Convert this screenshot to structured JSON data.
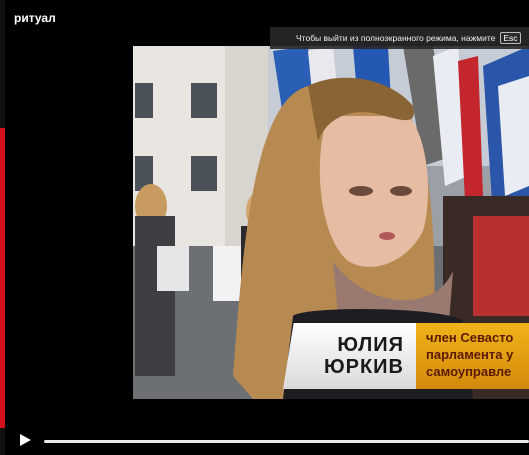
{
  "window": {
    "title": "ритуал"
  },
  "fullscreen_hint": {
    "text": "Чтобы выйти из полноэкранного режима, нажмите",
    "key": "Esc"
  },
  "lower_third": {
    "name_line1": "ЮЛИЯ",
    "name_line2": "ЮРКИВ",
    "role_line1": "член Севасто",
    "role_line2": "парламента у",
    "role_line3": "самоуправле"
  },
  "player": {
    "progress": 0.0
  },
  "colors": {
    "accent_orange": "#e5a012",
    "strip_red": "#d4101a"
  },
  "icons": {
    "play": "play-icon"
  }
}
